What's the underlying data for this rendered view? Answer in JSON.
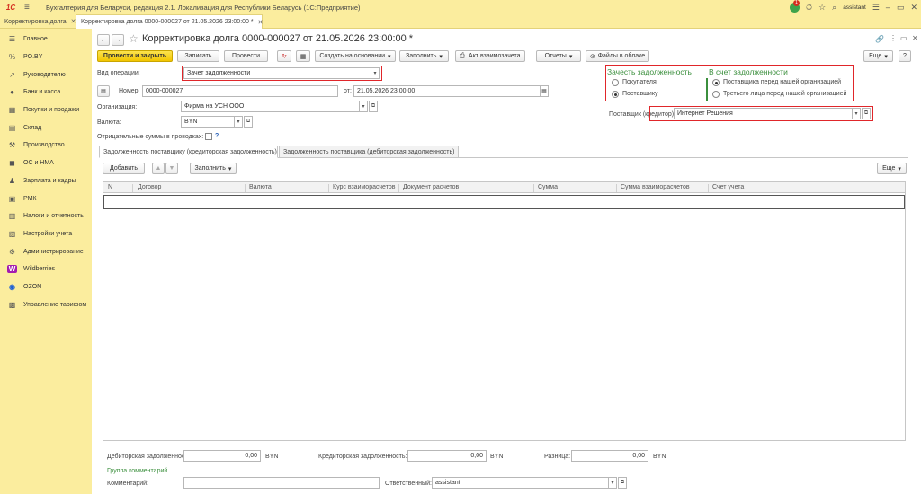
{
  "app": {
    "logo": "1С",
    "title": "Бухгалтерия для Беларуси, редакция 2.1. Локализация для Республики Беларусь   (1С:Предприятие)",
    "notifications_count": "1",
    "user": "assistant"
  },
  "tabs": [
    {
      "label": "Корректировка долга"
    },
    {
      "label": "Корректировка долга 0000-000027 от 21.05.2026 23:00:00 *"
    }
  ],
  "sidebar": {
    "items": [
      {
        "label": "Главное",
        "icon": "menu-icon"
      },
      {
        "label": "PO.BY",
        "icon": "percent-icon"
      },
      {
        "label": "Руководителю",
        "icon": "chart-icon"
      },
      {
        "label": "Банк и касса",
        "icon": "bank-icon"
      },
      {
        "label": "Покупки и продажи",
        "icon": "cart-icon"
      },
      {
        "label": "Склад",
        "icon": "warehouse-icon"
      },
      {
        "label": "Производство",
        "icon": "factory-icon"
      },
      {
        "label": "ОС и НМА",
        "icon": "car-icon"
      },
      {
        "label": "Зарплата и кадры",
        "icon": "people-icon"
      },
      {
        "label": "РМК",
        "icon": "register-icon"
      },
      {
        "label": "Налоги и отчетность",
        "icon": "tax-icon"
      },
      {
        "label": "Настройки учета",
        "icon": "settings-icon"
      },
      {
        "label": "Администрирование",
        "icon": "gear-icon"
      },
      {
        "label": "Wildberries",
        "icon": "wildberries-icon"
      },
      {
        "label": "OZON",
        "icon": "ozon-icon"
      },
      {
        "label": "Управление тарифом",
        "icon": "tariff-icon"
      }
    ]
  },
  "doc": {
    "title": "Корректировка долга 0000-000027 от 21.05.2026 23:00:00 *"
  },
  "toolbar": {
    "post_close": "Провести и закрыть",
    "save": "Записать",
    "post": "Провести",
    "create_based": "Создать на основании",
    "fill": "Заполнить",
    "offset_act": "Акт взаимозачета",
    "reports": "Отчеты",
    "cloud_files": "Файлы в облаке",
    "more": "Еще",
    "help": "?"
  },
  "form": {
    "operation_label": "Вид операции:",
    "operation_value": "Зачет задолженности",
    "number_label": "Номер:",
    "number_value": "0000-000027",
    "date_label": "от:",
    "date_value": "21.05.2026 23:00:00",
    "org_label": "Организация:",
    "org_value": "Фирма на УСН ООО",
    "currency_label": "Валюта:",
    "currency_value": "BYN",
    "negative_label": "Отрицательные суммы в проводках:",
    "negative_help": "?",
    "offset_title": "Зачесть задолженность",
    "offset_buyer": "Покупателя",
    "offset_supplier": "Поставщику",
    "against_title": "В счет задолженности",
    "against_supplier": "Поставщика перед нашей организацией",
    "against_third": "Третьего лица перед нашей организацией",
    "supplier_label": "Поставщик (кредитор):",
    "supplier_value": "Интернет Решения"
  },
  "inner_tabs": [
    {
      "label": "Задолженность поставщику (кредиторская задолженность)"
    },
    {
      "label": "Задолженность поставщика (дебиторская задолженность)"
    }
  ],
  "table_toolbar": {
    "add": "Добавить",
    "fill": "Заполнить",
    "more": "Еще"
  },
  "table": {
    "columns": [
      "N",
      "Договор",
      "Валюта",
      "Курс взаиморасчетов",
      "Документ расчетов",
      "Сумма",
      "Сумма взаиморасчетов",
      "Счет учета"
    ]
  },
  "footer": {
    "debt_debit_label": "Дебиторская задолженность:",
    "debt_debit_value": "0,00",
    "debt_debit_cur": "BYN",
    "debt_credit_label": "Кредиторская задолженность:",
    "debt_credit_value": "0,00",
    "debt_credit_cur": "BYN",
    "diff_label": "Разница:",
    "diff_value": "0,00",
    "diff_cur": "BYN",
    "comments_group": "Группа комментарий",
    "comment_label": "Комментарий:",
    "comment_value": "",
    "responsible_label": "Ответственный:",
    "responsible_value": "assistant"
  }
}
